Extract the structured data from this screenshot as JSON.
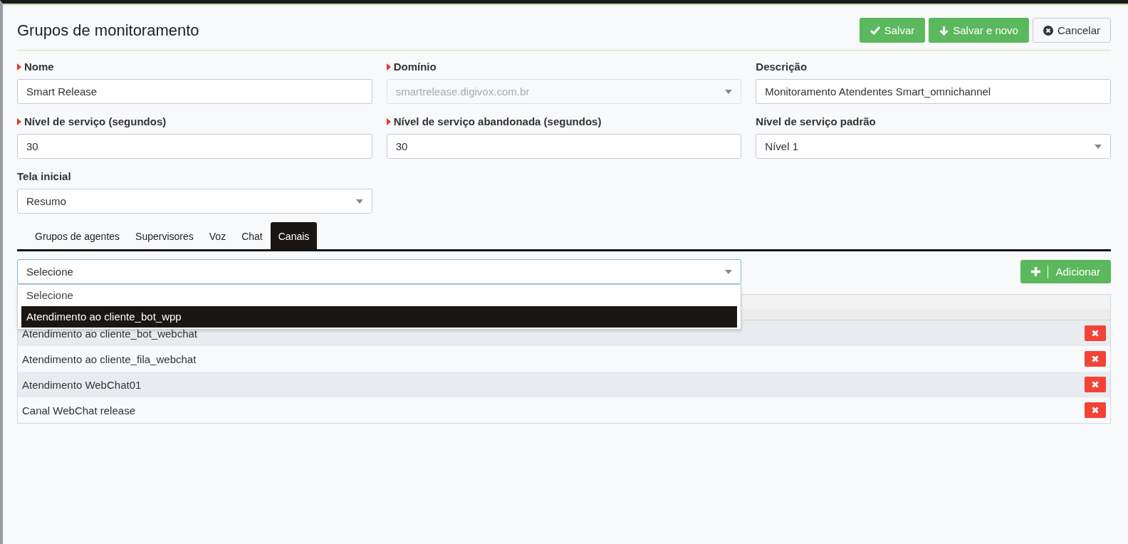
{
  "page": {
    "title": "Grupos de monitoramento"
  },
  "actions": [
    {
      "kind": "save",
      "label": "Salvar"
    },
    {
      "kind": "save_new",
      "label": "Salvar e novo"
    },
    {
      "kind": "cancel",
      "label": "Cancelar"
    }
  ],
  "fields": [
    {
      "label": "Nome",
      "required": true,
      "kind": "text",
      "value": "Smart Release",
      "disabled": false
    },
    {
      "label": "Domínio",
      "required": true,
      "kind": "select",
      "value": "smartrelease.digivox.com.br",
      "disabled": true
    },
    {
      "label": "Descrição",
      "required": false,
      "kind": "text",
      "value": "Monitoramento Atendentes Smart_omnichannel",
      "disabled": false
    },
    {
      "label": "Nível de serviço (segundos)",
      "required": true,
      "kind": "text",
      "value": "30",
      "disabled": false
    },
    {
      "label": "Nível de serviço abandonada (segundos)",
      "required": true,
      "kind": "text",
      "value": "30",
      "disabled": false
    },
    {
      "label": "Nível de serviço padrão",
      "required": false,
      "kind": "select",
      "value": "Nível 1",
      "disabled": false
    },
    {
      "label": "Tela inicial",
      "required": false,
      "kind": "select",
      "value": "Resumo",
      "disabled": false
    }
  ],
  "tabs": [
    {
      "label": "Grupos de agentes",
      "selected": false
    },
    {
      "label": "Supervisores",
      "selected": false
    },
    {
      "label": "Voz",
      "selected": false
    },
    {
      "label": "Chat",
      "selected": false
    },
    {
      "label": "Canais",
      "selected": true
    }
  ],
  "channel_select": {
    "value": "Selecione",
    "expanded": true,
    "options": [
      {
        "label": "Selecione",
        "highlighted": false
      },
      {
        "label": "Atendimento ao cliente_bot_wpp",
        "highlighted": true
      }
    ]
  },
  "add_button": {
    "label": "Adicionar"
  },
  "table": {
    "rows": [
      {
        "name": "Atendimento ao cliente_bot_webchat"
      },
      {
        "name": "Atendimento ao cliente_fila_webchat"
      },
      {
        "name": "Atendimento WebChat01"
      },
      {
        "name": "Canal WebChat release"
      }
    ]
  }
}
